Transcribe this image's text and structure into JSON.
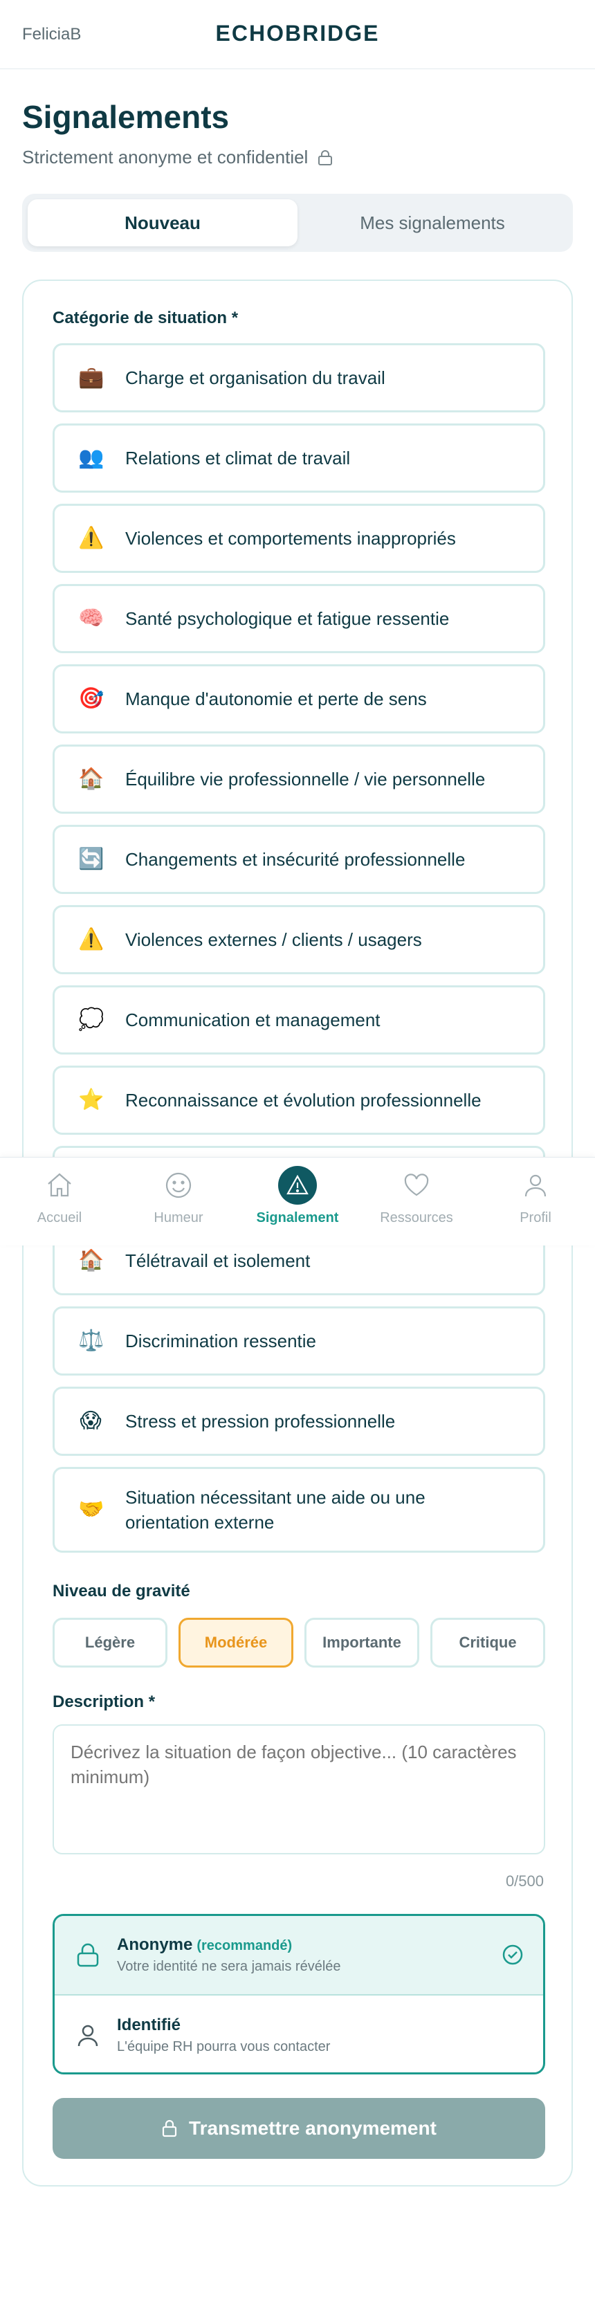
{
  "header": {
    "user": "FeliciaB",
    "brand": "ECHOBRIDGE"
  },
  "page": {
    "title": "Signalements",
    "subtitle": "Strictement anonyme et confidentiel"
  },
  "tabs": [
    {
      "label": "Nouveau"
    },
    {
      "label": "Mes signalements"
    }
  ],
  "form": {
    "category_label": "Catégorie de situation *",
    "categories": [
      {
        "icon": "briefcase-icon",
        "emoji": "💼",
        "label": "Charge et organisation du travail"
      },
      {
        "icon": "people-icon",
        "emoji": "👥",
        "label": "Relations et climat de travail"
      },
      {
        "icon": "warning-icon",
        "emoji": "⚠️",
        "label": "Violences et comportements inappropriés"
      },
      {
        "icon": "brain-icon",
        "emoji": "🧠",
        "label": "Santé psychologique et fatigue ressentie"
      },
      {
        "icon": "target-icon",
        "emoji": "🎯",
        "label": "Manque d'autonomie et perte de sens"
      },
      {
        "icon": "house-icon",
        "emoji": "🏠",
        "label": "Équilibre vie professionnelle / vie personnelle"
      },
      {
        "icon": "refresh-icon",
        "emoji": "🔄",
        "label": "Changements et insécurité professionnelle"
      },
      {
        "icon": "warning-icon",
        "emoji": "⚠️",
        "label": "Violences externes / clients / usagers"
      },
      {
        "icon": "speech-bubble-icon",
        "emoji": "💭",
        "label": "Communication et management"
      },
      {
        "icon": "star-icon",
        "emoji": "⭐",
        "label": "Reconnaissance et évolution professionnelle"
      },
      {
        "icon": "house-icon",
        "emoji": "🏠",
        "label": "Télétravail et isolement"
      },
      {
        "icon": "scales-icon",
        "emoji": "⚖️",
        "label": "Discrimination ressentie"
      },
      {
        "icon": "scream-face-icon",
        "emoji": "😱",
        "label": "Stress et pression professionnelle"
      },
      {
        "icon": "handshake-icon",
        "emoji": "🤝",
        "label": "Situation nécessitant une aide ou une orientation externe"
      }
    ],
    "severity_label": "Niveau de gravité",
    "severities": [
      {
        "label": "Légère"
      },
      {
        "label": "Modérée",
        "selected": true
      },
      {
        "label": "Importante"
      },
      {
        "label": "Critique"
      }
    ],
    "description_label": "Description *",
    "description_placeholder": "Décrivez la situation de façon objective... (10 caractères minimum)",
    "description_value": "",
    "char_count": "0/500",
    "anonymity": {
      "anonymous_title": "Anonyme",
      "anonymous_tag": "(recommandé)",
      "anonymous_desc": "Votre identité ne sera jamais révélée",
      "identified_title": "Identifié",
      "identified_desc": "L'équipe RH pourra vous contacter"
    },
    "submit_label": "Transmettre anonymement"
  },
  "bottom_nav": [
    {
      "icon": "home-icon",
      "label": "Accueil"
    },
    {
      "icon": "smiley-icon",
      "label": "Humeur"
    },
    {
      "icon": "warning-triangle-icon",
      "label": "Signalement",
      "active": true
    },
    {
      "icon": "heart-icon",
      "label": "Ressources"
    },
    {
      "icon": "profile-icon",
      "label": "Profil"
    }
  ],
  "colors": {
    "primary": "#0f5962",
    "accent": "#1a9a8d",
    "warning": "#f0a830",
    "text": "#0f3a44"
  }
}
